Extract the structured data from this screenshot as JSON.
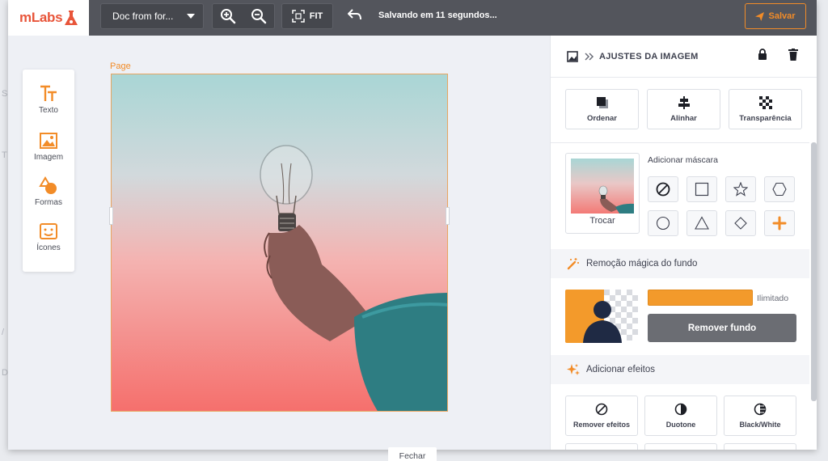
{
  "logo": {
    "text": "mLabs"
  },
  "toolbar": {
    "doc_name": "Doc from for...",
    "fit_label": "FIT",
    "saving_status": "Salvando em 11 segundos...",
    "save_label": "Salvar"
  },
  "tools": [
    {
      "label": "Texto",
      "icon": "text-icon"
    },
    {
      "label": "Imagem",
      "icon": "image-icon"
    },
    {
      "label": "Formas",
      "icon": "shapes-icon"
    },
    {
      "label": "Ícones",
      "icon": "emoji-icon"
    }
  ],
  "canvas": {
    "page_label": "Page"
  },
  "panel": {
    "title": "AJUSTES DA IMAGEM",
    "actions": [
      {
        "label": "Ordenar",
        "icon": "layers-icon"
      },
      {
        "label": "Alinhar",
        "icon": "align-icon"
      },
      {
        "label": "Transparência",
        "icon": "transparency-icon"
      }
    ],
    "mask": {
      "title": "Adicionar máscara",
      "swap_label": "Trocar",
      "shapes": [
        "none",
        "square",
        "star",
        "hexagon",
        "circle",
        "triangle",
        "diamond",
        "plus"
      ]
    },
    "magic_removal": {
      "title": "Remoção mágica do fundo",
      "quota_label": "Ilimitado",
      "button_label": "Remover fundo"
    },
    "effects": {
      "title": "Adicionar efeitos",
      "items": [
        {
          "label": "Remover efeitos",
          "icon": "no-effect-icon"
        },
        {
          "label": "Duotone",
          "icon": "duotone-icon"
        },
        {
          "label": "Black/White",
          "icon": "black-white-icon"
        }
      ]
    }
  },
  "footer": {
    "close_label": "Fechar"
  },
  "colors": {
    "accent": "#f28c28",
    "topbar": "#53555c",
    "panel_bg": "#ffffff"
  }
}
